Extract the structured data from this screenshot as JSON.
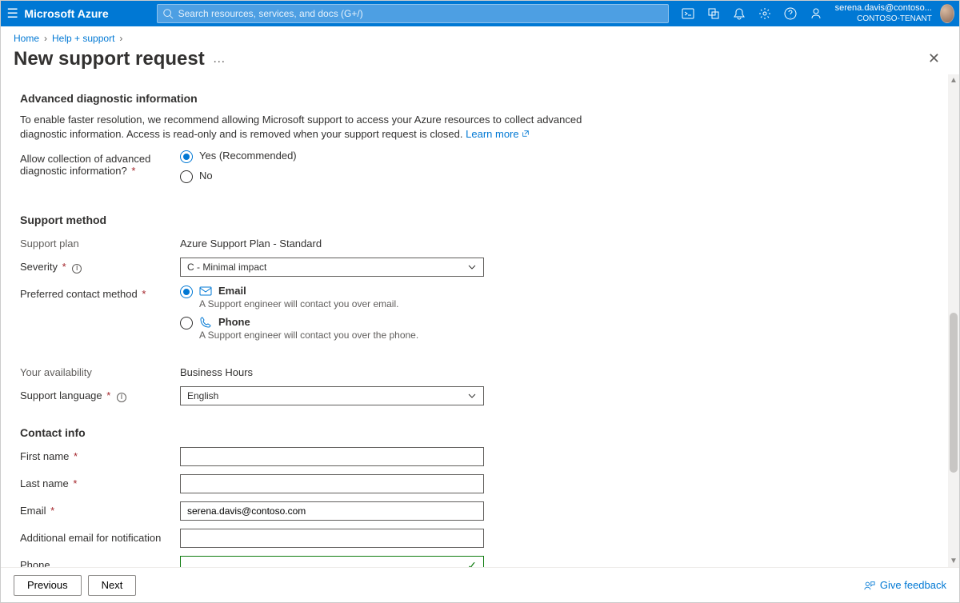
{
  "topbar": {
    "brand": "Microsoft Azure",
    "search_placeholder": "Search resources, services, and docs (G+/)",
    "account_email": "serena.davis@contoso...",
    "account_tenant": "CONTOSO-TENANT"
  },
  "breadcrumbs": {
    "home": "Home",
    "help": "Help + support"
  },
  "title": "New support request",
  "adv": {
    "heading": "Advanced diagnostic information",
    "desc_a": "To enable faster resolution, we recommend allowing Microsoft support to access your Azure resources to collect advanced diagnostic information. Access is read-only and is removed when your support request is closed. ",
    "learn": "Learn more",
    "label": "Allow collection of advanced diagnostic information?",
    "opt_yes": "Yes (Recommended)",
    "opt_no": "No"
  },
  "method": {
    "heading": "Support method",
    "plan_label": "Support plan",
    "plan_value": "Azure Support Plan - Standard",
    "severity_label": "Severity",
    "severity_value": "C - Minimal impact",
    "pref_label": "Preferred contact method",
    "email_label": "Email",
    "email_sub": "A Support engineer will contact you over email.",
    "phone_label": "Phone",
    "phone_sub": "A Support engineer will contact you over the phone.",
    "avail_label": "Your availability",
    "avail_value": "Business Hours",
    "lang_label": "Support language",
    "lang_value": "English"
  },
  "contact": {
    "heading": "Contact info",
    "first_label": "First name",
    "last_label": "Last name",
    "email_label": "Email",
    "email_value": "serena.davis@contoso.com",
    "addl_label": "Additional email for notification",
    "phone_label": "Phone"
  },
  "footer": {
    "prev": "Previous",
    "next": "Next",
    "feedback": "Give feedback"
  }
}
